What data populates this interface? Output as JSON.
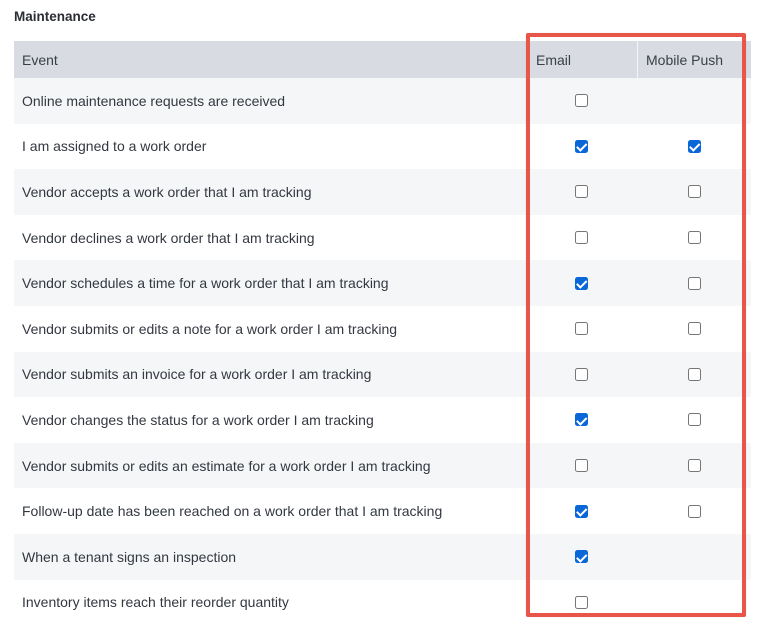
{
  "section": {
    "title": "Maintenance"
  },
  "table": {
    "headers": {
      "event": "Event",
      "email": "Email",
      "push": "Mobile Push"
    },
    "rows": [
      {
        "event": "Online maintenance requests are received",
        "email": false,
        "push": null
      },
      {
        "event": "I am assigned to a work order",
        "email": true,
        "push": true
      },
      {
        "event": "Vendor accepts a work order that I am tracking",
        "email": false,
        "push": false
      },
      {
        "event": "Vendor declines a work order that I am tracking",
        "email": false,
        "push": false
      },
      {
        "event": "Vendor schedules a time for a work order that I am tracking",
        "email": true,
        "push": false
      },
      {
        "event": "Vendor submits or edits a note for a work order I am tracking",
        "email": false,
        "push": false
      },
      {
        "event": "Vendor submits an invoice for a work order I am tracking",
        "email": false,
        "push": false
      },
      {
        "event": "Vendor changes the status for a work order I am tracking",
        "email": true,
        "push": false
      },
      {
        "event": "Vendor submits or edits an estimate for a work order I am tracking",
        "email": false,
        "push": false
      },
      {
        "event": "Follow-up date has been reached on a work order that I am tracking",
        "email": true,
        "push": false
      },
      {
        "event": "When a tenant signs an inspection",
        "email": true,
        "push": null
      },
      {
        "event": "Inventory items reach their reorder quantity",
        "email": false,
        "push": null
      }
    ]
  },
  "colors": {
    "highlight": "#e8564a",
    "checked": "#0a67d8",
    "header_bg": "#d8dce2",
    "stripe_bg": "#f5f6f8"
  }
}
